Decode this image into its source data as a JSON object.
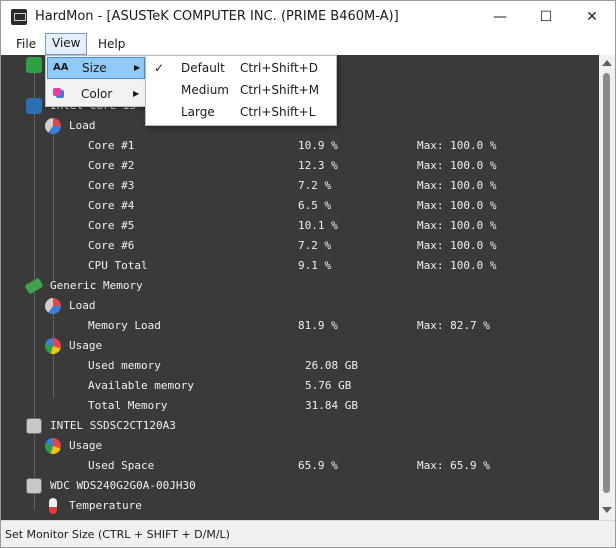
{
  "window": {
    "title": "HardMon - [ASUSTeK COMPUTER INC. (PRIME B460M-A)]",
    "minimize": "—",
    "maximize": "☐",
    "close": "✕"
  },
  "menubar": {
    "file": "File",
    "view": "View",
    "help": "Help"
  },
  "view_menu": {
    "size": "Size",
    "color": "Color",
    "size_icon": "AA"
  },
  "size_submenu": [
    {
      "label": "Default",
      "shortcut": "Ctrl+Shift+D",
      "checked": "✓"
    },
    {
      "label": "Medium",
      "shortcut": "Ctrl+Shift+M",
      "checked": ""
    },
    {
      "label": "Large",
      "shortcut": "Ctrl+Shift+L",
      "checked": ""
    }
  ],
  "tree": {
    "cpu_name_partial": "Intel Core i5",
    "cpu_load": "Load",
    "cores": [
      {
        "label": "Core #1",
        "value": "10.9 %",
        "max": "Max: 100.0 %"
      },
      {
        "label": "Core #2",
        "value": "12.3 %",
        "max": "Max: 100.0 %"
      },
      {
        "label": "Core #3",
        "value": "7.2 %",
        "max": "Max: 100.0 %"
      },
      {
        "label": "Core #4",
        "value": "6.5 %",
        "max": "Max: 100.0 %"
      },
      {
        "label": "Core #5",
        "value": "10.1 %",
        "max": "Max: 100.0 %"
      },
      {
        "label": "Core #6",
        "value": "7.2 %",
        "max": "Max: 100.0 %"
      },
      {
        "label": "CPU Total",
        "value": "9.1 %",
        "max": "Max: 100.0 %"
      }
    ],
    "memory": "Generic Memory",
    "memory_load_group": "Load",
    "memory_load": {
      "label": "Memory Load",
      "value": "81.9 %",
      "max": "Max: 82.7 %"
    },
    "usage_group": "Usage",
    "usage": [
      {
        "label": "Used memory",
        "value": "26.08 GB"
      },
      {
        "label": "Available memory",
        "value": "5.76 GB"
      },
      {
        "label": "Total Memory",
        "value": "31.84 GB"
      }
    ],
    "ssd": "INTEL SSDSC2CT120A3",
    "ssd_usage_group": "Usage",
    "ssd_used": {
      "label": "Used Space",
      "value": "65.9 %",
      "max": "Max: 65.9 %"
    },
    "wdc": "WDC WDS240G2G0A-00JH30",
    "wdc_temp": "Temperature"
  },
  "status": "Set Monitor Size (CTRL + SHIFT + D/M/L)"
}
